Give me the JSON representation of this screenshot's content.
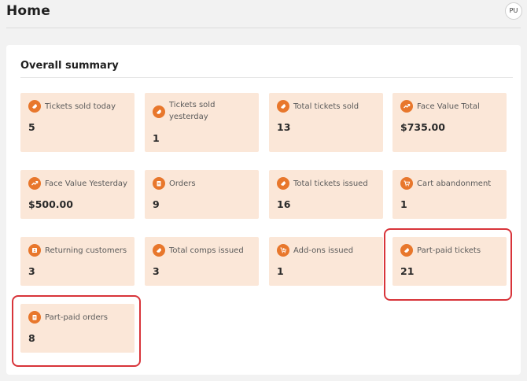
{
  "header": {
    "title": "Home",
    "avatar_initials": "PU"
  },
  "summary": {
    "title": "Overall summary",
    "tiles": [
      {
        "label": "Tickets sold today",
        "value": "5",
        "icon": "ticket-icon"
      },
      {
        "label": "Tickets sold yesterday",
        "value": "1",
        "icon": "ticket-icon"
      },
      {
        "label": "Total tickets sold",
        "value": "13",
        "icon": "ticket-icon"
      },
      {
        "label": "Face Value Total",
        "value": "$735.00",
        "icon": "trend-up-icon"
      },
      {
        "label": "Face Value Yesterday",
        "value": "$500.00",
        "icon": "trend-up-icon"
      },
      {
        "label": "Orders",
        "value": "9",
        "icon": "clipboard-icon"
      },
      {
        "label": "Total tickets issued",
        "value": "16",
        "icon": "ticket-icon"
      },
      {
        "label": "Cart abandonment",
        "value": "1",
        "icon": "cart-icon"
      },
      {
        "label": "Returning customers",
        "value": "3",
        "icon": "user-badge-icon"
      },
      {
        "label": "Total comps issued",
        "value": "3",
        "icon": "ticket-icon"
      },
      {
        "label": "Add-ons issued",
        "value": "1",
        "icon": "cart-plus-icon"
      },
      {
        "label": "Part-paid tickets",
        "value": "21",
        "icon": "ticket-icon"
      },
      {
        "label": "Part-paid orders",
        "value": "8",
        "icon": "clipboard-icon"
      }
    ]
  },
  "colors": {
    "accent": "#e8772c",
    "tile_background": "#fbe7d8",
    "highlight": "#d8343a"
  }
}
